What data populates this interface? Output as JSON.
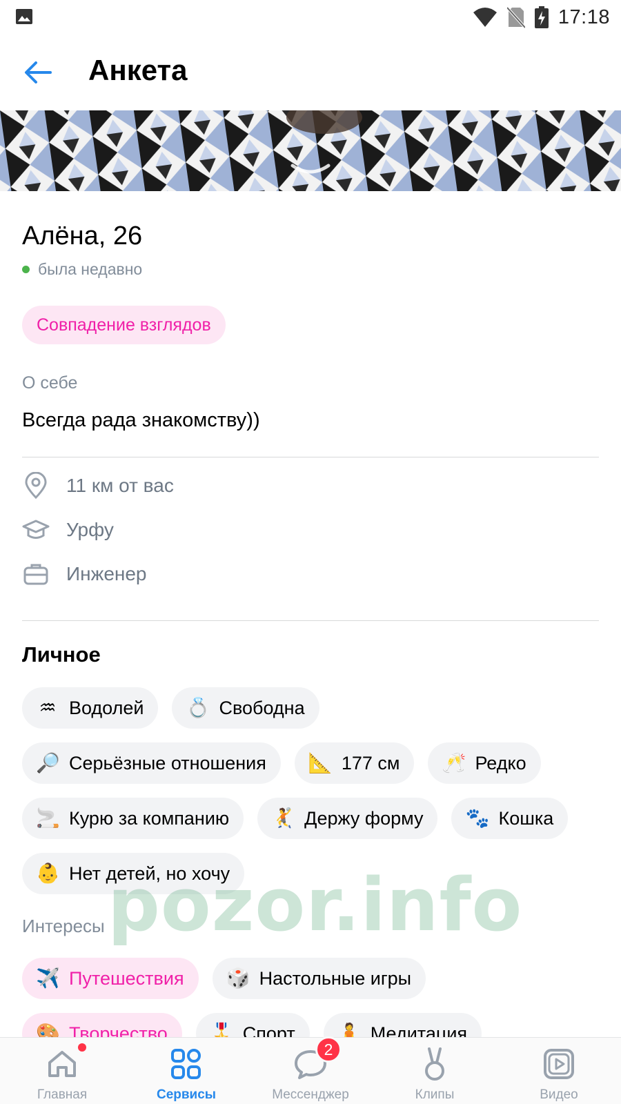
{
  "status_bar": {
    "time": "17:18",
    "icons": [
      "gallery-icon",
      "wifi-icon",
      "no-sim-icon",
      "battery-charging-icon"
    ]
  },
  "header": {
    "title": "Анкета",
    "back_icon": "arrow-left-icon"
  },
  "profile": {
    "name_age": "Алёна, 26",
    "online_status": "была недавно",
    "match_badge": "Совпадение взглядов",
    "about_label": "О себе",
    "about_text": "Всегда рада знакомству))",
    "info": [
      {
        "icon": "location-pin-icon",
        "text": "11 км от вас"
      },
      {
        "icon": "graduation-cap-icon",
        "text": "Урфу"
      },
      {
        "icon": "briefcase-icon",
        "text": "Инженер"
      }
    ]
  },
  "personal": {
    "title": "Личное",
    "chips": [
      {
        "emoji": "♒",
        "label": "Водолей"
      },
      {
        "emoji": "💍",
        "label": "Свободна"
      },
      {
        "emoji": "🔎",
        "label": "Серьёзные отношения"
      },
      {
        "emoji": "📐",
        "label": "177 см"
      },
      {
        "emoji": "🥂",
        "label": "Редко"
      },
      {
        "emoji": "🚬",
        "label": "Курю за компанию"
      },
      {
        "emoji": "🤾",
        "label": "Держу форму"
      },
      {
        "emoji": "🐾",
        "label": "Кошка"
      },
      {
        "emoji": "👶",
        "label": "Нет детей, но хочу"
      }
    ]
  },
  "interests": {
    "title": "Интересы",
    "chips": [
      {
        "emoji": "✈️",
        "label": "Путешествия",
        "highlighted": true
      },
      {
        "emoji": "🎲",
        "label": "Настольные игры",
        "highlighted": false
      },
      {
        "emoji": "🎨",
        "label": "Творчество",
        "highlighted": true
      },
      {
        "emoji": "🎖️",
        "label": "Спорт",
        "highlighted": false
      },
      {
        "emoji": "🧘",
        "label": "Медитация",
        "highlighted": false
      }
    ]
  },
  "watermark": "pozor.info",
  "tabbar": {
    "tabs": [
      {
        "label": "Главная",
        "icon": "home-icon",
        "active": false,
        "dot": true
      },
      {
        "label": "Сервисы",
        "icon": "services-grid-icon",
        "active": true
      },
      {
        "label": "Мессенджер",
        "icon": "messenger-icon",
        "active": false,
        "badge": "2"
      },
      {
        "label": "Клипы",
        "icon": "clips-icon",
        "active": false
      },
      {
        "label": "Видео",
        "icon": "video-icon",
        "active": false
      }
    ]
  },
  "colors": {
    "accent": "#2688eb",
    "pink_text": "#f020a8",
    "pink_bg": "#fde6f4",
    "chip_bg": "#f2f3f5",
    "secondary_text": "#818c99",
    "online": "#4bb34b",
    "badge": "#ff3347"
  }
}
